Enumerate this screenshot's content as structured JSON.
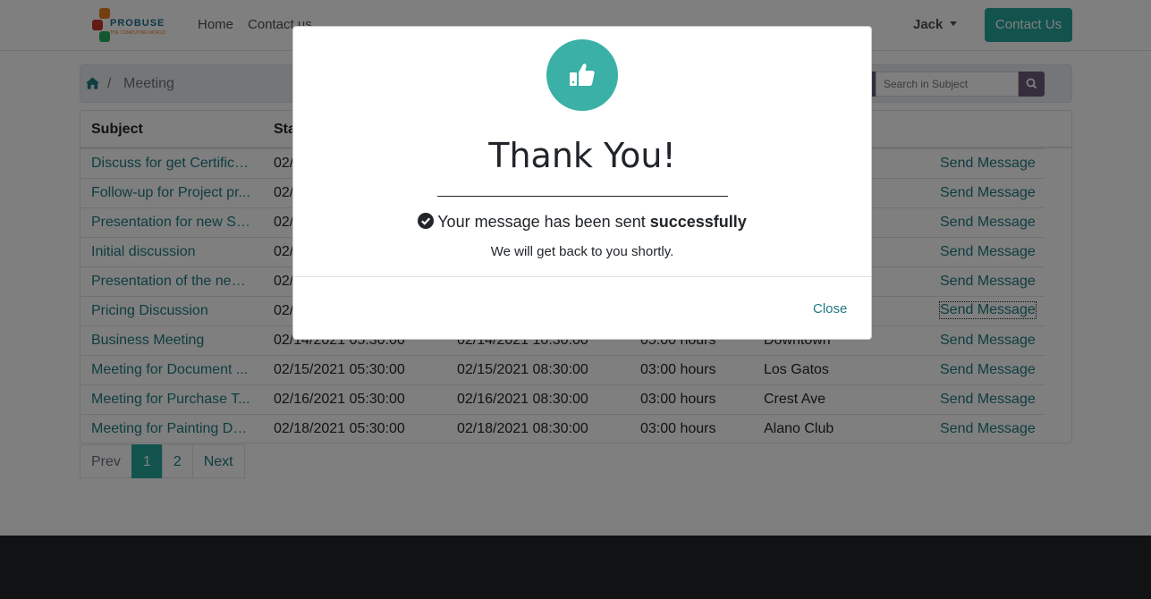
{
  "navbar": {
    "logo_text": "PROBUSE",
    "logo_sub": "THE COMPUTING WORLD",
    "nav_home": "Home",
    "nav_contact": "Contact us",
    "user": "Jack",
    "contact_button": "Contact Us"
  },
  "breadcrumb": {
    "separator": "/",
    "current": "Meeting"
  },
  "search": {
    "placeholder": "Search in Subject"
  },
  "table": {
    "headers": {
      "subject": "Subject",
      "start": "Start"
    },
    "rows": [
      {
        "subject": "Discuss for get Certifica...",
        "start": "02/",
        "end": "",
        "duration": "",
        "location": "",
        "action": "Send Message"
      },
      {
        "subject": "Follow-up for Project pr...",
        "start": "02/",
        "end": "",
        "duration": "",
        "location": "",
        "action": "Send Message"
      },
      {
        "subject": "Presentation for new Se...",
        "start": "02/",
        "end": "",
        "duration": "",
        "location": "",
        "action": "Send Message"
      },
      {
        "subject": "Initial discussion",
        "start": "02/",
        "end": "",
        "duration": "",
        "location": "",
        "action": "Send Message"
      },
      {
        "subject": "Presentation of the new...",
        "start": "02/",
        "end": "",
        "duration": "",
        "location": "",
        "action": "Send Message"
      },
      {
        "subject": "Pricing Discussion",
        "start": "02/",
        "end": "",
        "duration": "",
        "location": "",
        "action": "Send Message"
      },
      {
        "subject": "Business Meeting",
        "start": "02/14/2021 05:30:00",
        "end": "02/14/2021 10:30:00",
        "duration": "05:00 hours",
        "location": "Downtown",
        "action": "Send Message"
      },
      {
        "subject": "Meeting for Document ...",
        "start": "02/15/2021 05:30:00",
        "end": "02/15/2021 08:30:00",
        "duration": "03:00 hours",
        "location": "Los Gatos",
        "action": "Send Message"
      },
      {
        "subject": "Meeting for Purchase T...",
        "start": "02/16/2021 05:30:00",
        "end": "02/16/2021 08:30:00",
        "duration": "03:00 hours",
        "location": "Crest Ave",
        "action": "Send Message"
      },
      {
        "subject": "Meeting for Painting De...",
        "start": "02/18/2021 05:30:00",
        "end": "02/18/2021 08:30:00",
        "duration": "03:00 hours",
        "location": "Alano Club",
        "action": "Send Message"
      }
    ]
  },
  "pagination": {
    "prev": "Prev",
    "page1": "1",
    "page2": "2",
    "next": "Next"
  },
  "modal": {
    "title": "Thank You!",
    "message_prefix": "Your message has been sent",
    "message_bold": "successfully",
    "subtext": "We will get back to you shortly.",
    "close_label": "Close"
  },
  "colors": {
    "accent": "#26a69a",
    "link": "#1f7a80",
    "footer": "#212529",
    "search_button": "#6c5b7b"
  },
  "icons": {
    "home": "home-icon",
    "search": "search-icon",
    "thumbs_up": "thumbs-up-icon",
    "check_circle": "check-circle-icon",
    "caret": "caret-down-icon"
  }
}
